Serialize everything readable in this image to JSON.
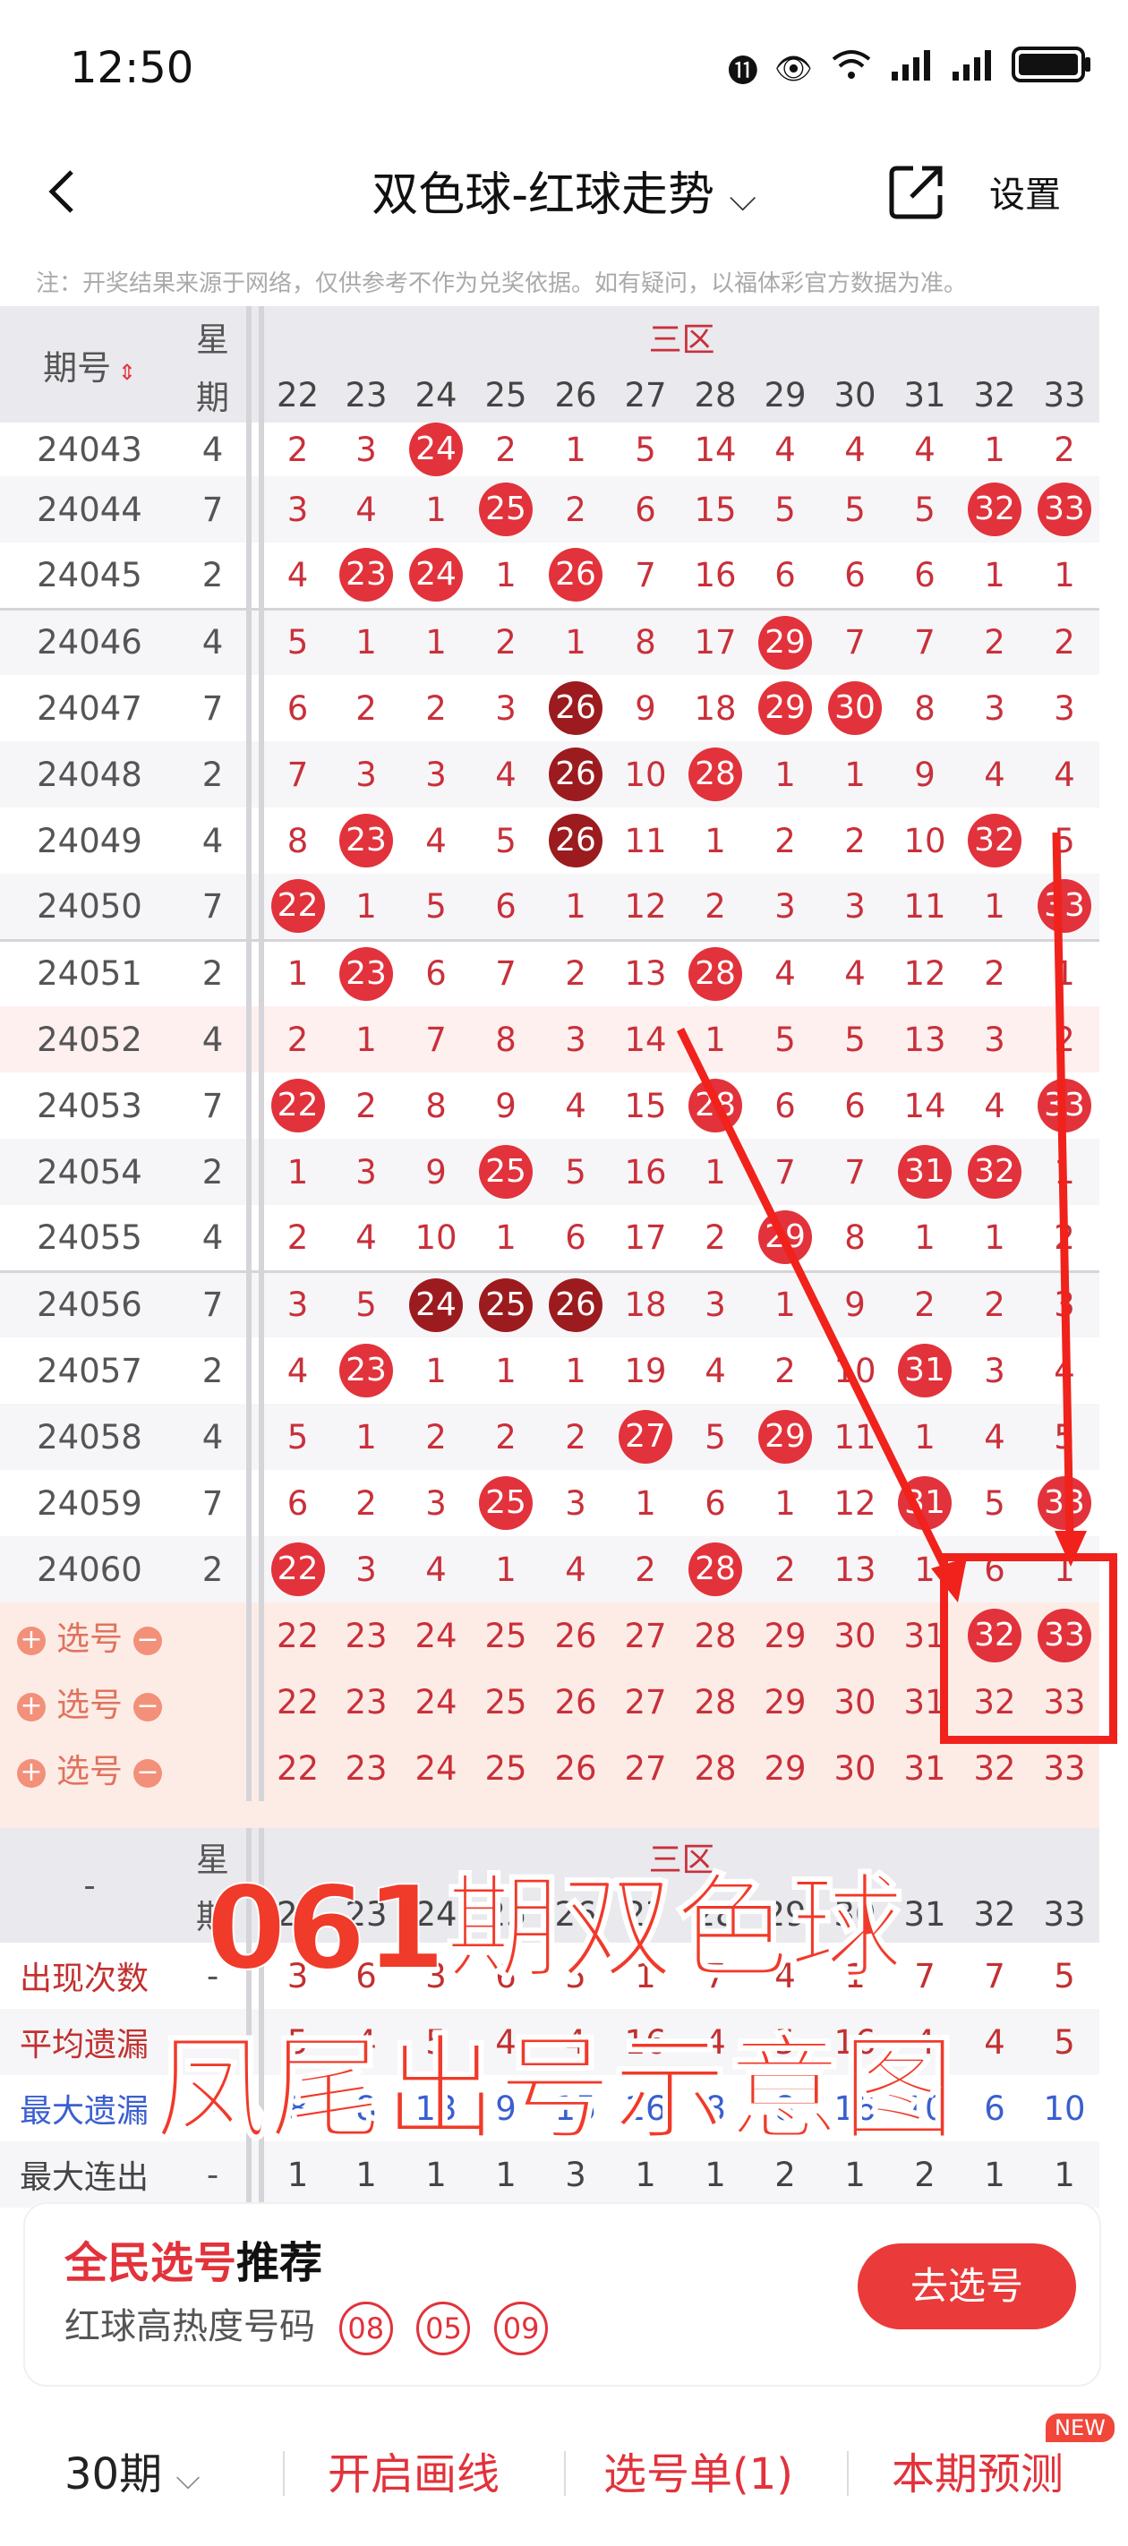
{
  "status_bar": {
    "time": "12:50",
    "icons": [
      "hd-icon",
      "eye-icon",
      "wifi-icon",
      "signal-icon",
      "signal-icon",
      "battery-icon"
    ]
  },
  "header": {
    "title": "双色球-红球走势",
    "settings": "设置"
  },
  "note": "注：开奖结果来源于网络，仅供参考不作为兑奖依据。如有疑问，以福体彩官方数据为准。",
  "table_header": {
    "issue": "期号",
    "weekday": [
      "星",
      "期"
    ],
    "zone": "三区",
    "numbers": [
      "22",
      "23",
      "24",
      "25",
      "26",
      "27",
      "28",
      "29",
      "30",
      "31",
      "32",
      "33"
    ]
  },
  "rows": [
    {
      "id": "24043",
      "wk": "4",
      "cells": [
        "2",
        "3",
        "24",
        "2",
        "1",
        "5",
        "14",
        "4",
        "4",
        "4",
        "1",
        "2"
      ]
    },
    {
      "id": "24044",
      "wk": "7",
      "cells": [
        "3",
        "4",
        "1",
        "25",
        "2",
        "6",
        "15",
        "5",
        "5",
        "5",
        "32",
        "33"
      ]
    },
    {
      "id": "24045",
      "wk": "2",
      "cells": [
        "4",
        "23",
        "24",
        "1",
        "26",
        "7",
        "16",
        "6",
        "6",
        "6",
        "1",
        "1"
      ]
    },
    {
      "id": "24046",
      "wk": "4",
      "cells": [
        "5",
        "1",
        "1",
        "2",
        "1",
        "8",
        "17",
        "29",
        "7",
        "7",
        "2",
        "2"
      ]
    },
    {
      "id": "24047",
      "wk": "7",
      "cells": [
        "6",
        "2",
        "2",
        "3",
        "26",
        "9",
        "18",
        "29",
        "30",
        "8",
        "3",
        "3"
      ]
    },
    {
      "id": "24048",
      "wk": "2",
      "cells": [
        "7",
        "3",
        "3",
        "4",
        "26",
        "10",
        "28",
        "1",
        "1",
        "9",
        "4",
        "4"
      ]
    },
    {
      "id": "24049",
      "wk": "4",
      "cells": [
        "8",
        "23",
        "4",
        "5",
        "26",
        "11",
        "1",
        "2",
        "2",
        "10",
        "32",
        "5"
      ]
    },
    {
      "id": "24050",
      "wk": "7",
      "cells": [
        "22",
        "1",
        "5",
        "6",
        "1",
        "12",
        "2",
        "3",
        "3",
        "11",
        "1",
        "33"
      ]
    },
    {
      "id": "24051",
      "wk": "2",
      "cells": [
        "1",
        "23",
        "6",
        "7",
        "2",
        "13",
        "28",
        "4",
        "4",
        "12",
        "2",
        "1"
      ]
    },
    {
      "id": "24052",
      "wk": "4",
      "cells": [
        "2",
        "1",
        "7",
        "8",
        "3",
        "14",
        "1",
        "5",
        "5",
        "13",
        "3",
        "2"
      ]
    },
    {
      "id": "24053",
      "wk": "7",
      "cells": [
        "22",
        "2",
        "8",
        "9",
        "4",
        "15",
        "28",
        "6",
        "6",
        "14",
        "4",
        "33"
      ]
    },
    {
      "id": "24054",
      "wk": "2",
      "cells": [
        "1",
        "3",
        "9",
        "25",
        "5",
        "16",
        "1",
        "7",
        "7",
        "31",
        "32",
        "1"
      ]
    },
    {
      "id": "24055",
      "wk": "4",
      "cells": [
        "2",
        "4",
        "10",
        "1",
        "6",
        "17",
        "2",
        "29",
        "8",
        "1",
        "1",
        "2"
      ]
    },
    {
      "id": "24056",
      "wk": "7",
      "cells": [
        "3",
        "5",
        "24",
        "25",
        "26",
        "18",
        "3",
        "1",
        "9",
        "2",
        "2",
        "3"
      ]
    },
    {
      "id": "24057",
      "wk": "2",
      "cells": [
        "4",
        "23",
        "1",
        "1",
        "1",
        "19",
        "4",
        "2",
        "10",
        "31",
        "3",
        "4"
      ]
    },
    {
      "id": "24058",
      "wk": "4",
      "cells": [
        "5",
        "1",
        "2",
        "2",
        "2",
        "27",
        "5",
        "29",
        "11",
        "1",
        "4",
        "5"
      ]
    },
    {
      "id": "24059",
      "wk": "7",
      "cells": [
        "6",
        "2",
        "3",
        "25",
        "3",
        "1",
        "6",
        "1",
        "12",
        "31",
        "5",
        "33"
      ]
    },
    {
      "id": "24060",
      "wk": "2",
      "cells": [
        "22",
        "3",
        "4",
        "1",
        "4",
        "2",
        "28",
        "2",
        "13",
        "1",
        "6",
        "1"
      ]
    }
  ],
  "select_rows": [
    {
      "label": "选号",
      "selected": [
        "32",
        "33"
      ]
    },
    {
      "label": "选号",
      "selected": []
    },
    {
      "label": "选号",
      "selected": []
    }
  ],
  "stats_header": {
    "issue": "-",
    "weekday": [
      "星",
      "期"
    ],
    "zone": "三区"
  },
  "stats": [
    {
      "label": "出现次数",
      "wk": "-",
      "values": [
        "3",
        "6",
        "3",
        "6",
        "5",
        "1",
        "7",
        "4",
        "1",
        "7",
        "7",
        "5"
      ]
    },
    {
      "label": "平均遗漏",
      "wk": "-",
      "values": [
        "5",
        "4",
        "5",
        "4",
        "4",
        "16",
        "4",
        "5",
        "16",
        "4",
        "4",
        "5"
      ]
    },
    {
      "label": "最大遗漏",
      "wk": "-",
      "values": [
        "8",
        "8",
        "13",
        "9",
        "15",
        "16",
        "8",
        "8",
        "16",
        "10",
        "6",
        "10"
      ]
    },
    {
      "label": "最大连出",
      "wk": "-",
      "values": [
        "1",
        "1",
        "1",
        "1",
        "3",
        "1",
        "1",
        "2",
        "1",
        "2",
        "1",
        "1"
      ]
    }
  ],
  "overlay": {
    "line1": "061期双色球",
    "line2": "凤尾出号示意图"
  },
  "promo": {
    "title_red": "全民选号",
    "title_black": "推荐",
    "subtitle": "红球高热度号码",
    "hot_numbers": [
      "08",
      "05",
      "09"
    ],
    "button": "去选号"
  },
  "bottom_bar": {
    "periods": "30期",
    "draw_line": "开启画线",
    "pick_list": "选号单(1)",
    "forecast": "本期预测",
    "new_badge": "NEW"
  },
  "colors": {
    "ball_red": "#e2323b",
    "ball_dark": "#9c1b1f",
    "accent": "#ea3a3a",
    "annotation_red": "#f0221b"
  }
}
